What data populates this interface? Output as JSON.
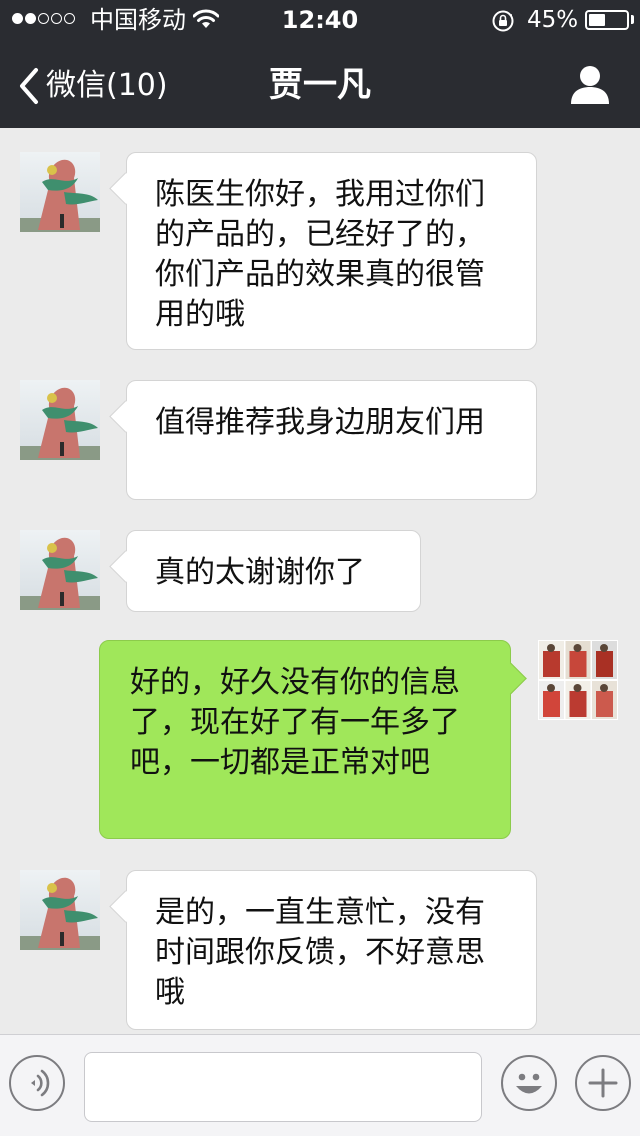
{
  "status_bar": {
    "carrier": "中国移动",
    "time": "12:40",
    "battery_percent_label": "45%",
    "battery_level": 0.45,
    "signal_bars_filled": 2,
    "signal_bars_total": 5
  },
  "nav": {
    "back_label": "微信(10)",
    "title": "贾一凡",
    "back_icon": "chevron-left-icon",
    "right_icon": "person-icon"
  },
  "messages": [
    {
      "side": "in",
      "text": "陈医生你好，我用过你们\n的产品的，已经好了的，\n你们产品的效果真的很管\n用的哦"
    },
    {
      "side": "in",
      "text": "值得推荐我身边朋友们用"
    },
    {
      "side": "in",
      "text": "真的太谢谢你了"
    },
    {
      "side": "out",
      "text": "好的，好久没有你的信息\n了，现在好了有一年多了\n吧，一切都是正常对吧"
    },
    {
      "side": "in",
      "text": "是的，一直生意忙，没有\n时间跟你反馈，不好意思\n哦"
    }
  ],
  "input_bar": {
    "voice_icon": "voice-icon",
    "emoji_icon": "emoji-icon",
    "more_icon": "plus-icon",
    "text_value": ""
  },
  "colors": {
    "header_bg": "#2a2c31",
    "chat_bg": "#ebebeb",
    "outgoing_bubble": "#a0e75a",
    "incoming_bubble": "#ffffff"
  }
}
